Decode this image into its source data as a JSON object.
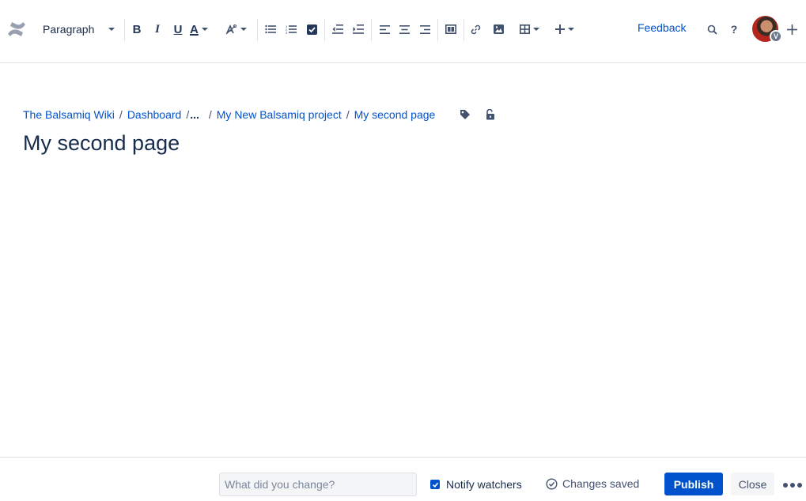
{
  "toolbar": {
    "logo_icon": "confluence-logo-icon",
    "paragraph_style": "Paragraph",
    "bold_label": "B",
    "italic_label": "I",
    "underline_label": "U",
    "text_color_label": "A",
    "feedback_label": "Feedback",
    "help_label": "?",
    "avatar_badge": "V",
    "colors": {
      "icon": "#42526e",
      "link": "#0052cc",
      "text_color_underline": "#253858"
    }
  },
  "breadcrumb": {
    "items": [
      "The Balsamiq Wiki",
      "Dashboard",
      "My New Balsamiq project",
      "My second page"
    ],
    "separator": "/",
    "ellipsis": "..."
  },
  "page": {
    "title": "My second page"
  },
  "footer": {
    "change_placeholder": "What did you change?",
    "notify_label": "Notify watchers",
    "notify_checked": true,
    "status_label": "Changes saved",
    "publish_label": "Publish",
    "close_label": "Close",
    "colors": {
      "primary": "#0052cc",
      "secondary_bg": "#f4f5f7"
    }
  }
}
